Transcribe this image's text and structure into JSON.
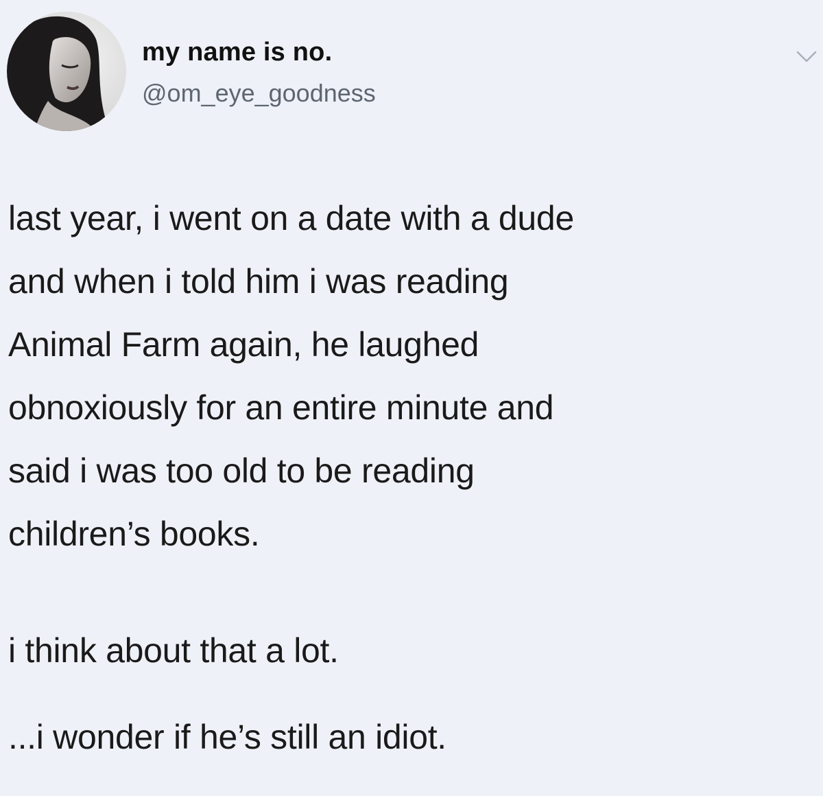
{
  "tweet": {
    "author": {
      "display_name": "my name is no.",
      "handle": "@om_eye_goodness",
      "avatar_icon": "profile-photo"
    },
    "menu_icon": "chevron-down-icon",
    "paragraphs": [
      {
        "lines": [
          "last year, i went on a date with a dude",
          "and when i told him i was reading",
          "Animal Farm again, he laughed",
          "obnoxiously for an entire minute and",
          "said i was too old to be reading",
          "children’s books."
        ]
      },
      {
        "lines": [
          "i think about that a lot."
        ]
      },
      {
        "lines": [
          "...i wonder if he’s still an idiot."
        ]
      }
    ]
  },
  "colors": {
    "background": "#eff1f8",
    "text": "#1a1a1a",
    "handle": "#5d6670",
    "chevron": "#a8b0bb"
  }
}
